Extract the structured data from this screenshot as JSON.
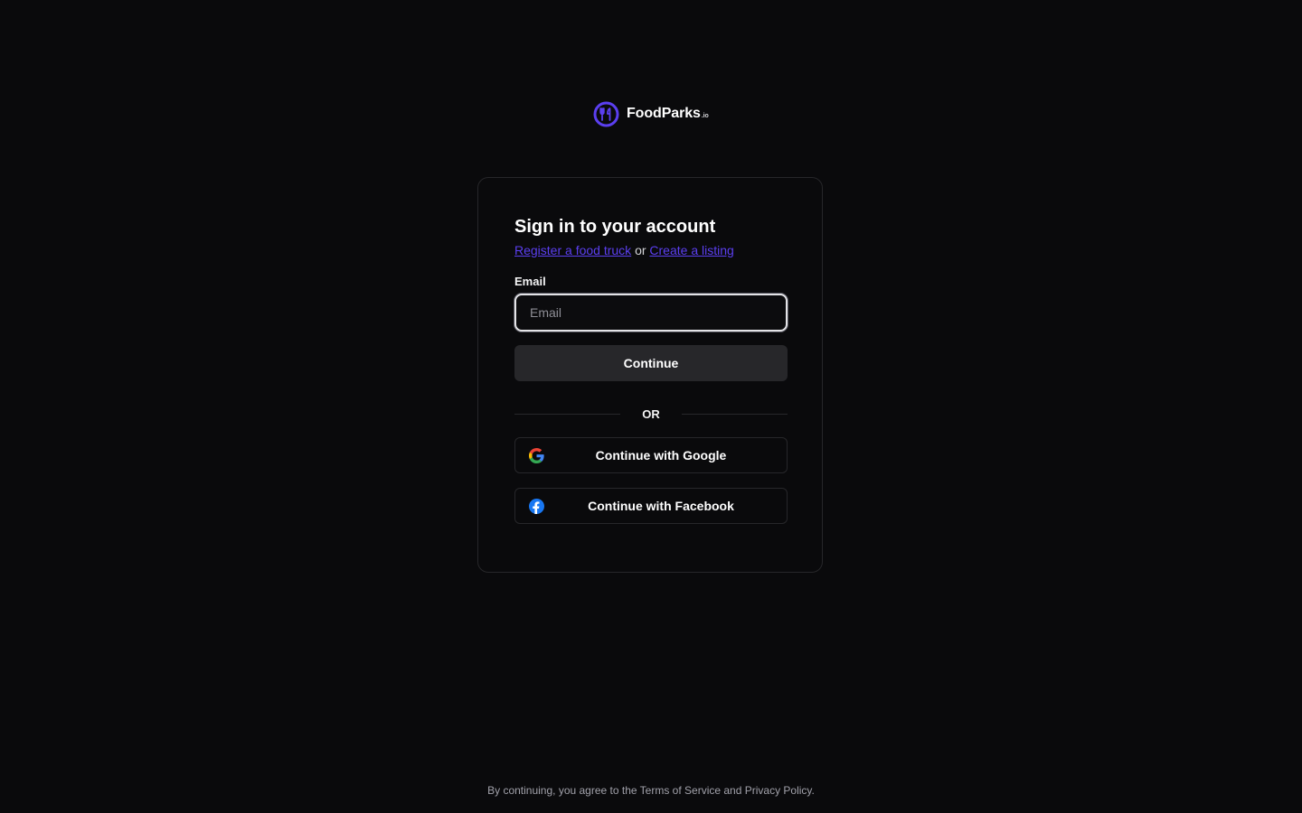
{
  "brand": {
    "name": "FoodParks",
    "suffix": ".io",
    "logo_icon": "fork-knife-icon",
    "accent_color": "#5b3ff0"
  },
  "signin": {
    "title": "Sign in to your account",
    "register_link": "Register a food truck",
    "or_text": "or",
    "create_link": "Create a listing",
    "email_label": "Email",
    "email_placeholder": "Email",
    "email_value": "",
    "continue_label": "Continue",
    "divider_text": "OR",
    "google_label": "Continue with Google",
    "google_icon": "google-icon",
    "facebook_label": "Continue with Facebook",
    "facebook_icon": "facebook-icon"
  },
  "footer": {
    "prefix": "By continuing, you agree to the ",
    "terms": "Terms of Service",
    "and": " and ",
    "privacy": "Privacy Policy",
    "suffix": "."
  }
}
